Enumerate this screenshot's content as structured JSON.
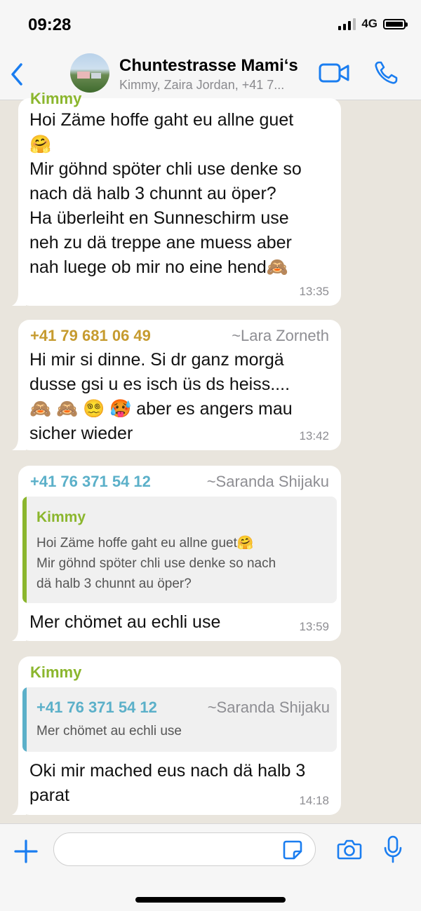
{
  "status": {
    "time": "09:28",
    "network": "4G"
  },
  "header": {
    "title": "Chuntestrasse Mami‘s",
    "subtitle": "Kimmy, Zaira Jordan, +41 7..."
  },
  "messages": [
    {
      "sender": "Kimmy",
      "lines": [
        "Hoi Zäme hoffe gaht eu allne guet",
        "🤗",
        "Mir göhnd spöter chli use denke so",
        "nach dä halb 3 chunnt au öper?",
        "Ha überleiht en Sunneschirm use",
        "neh zu dä treppe ane muess aber",
        "nah luege ob mir no eine hend🙈"
      ],
      "time": "13:35"
    },
    {
      "sender_phone": "+41 79 681 06 49",
      "sender_alias": "~Lara Zorneth",
      "lines": [
        "Hi mir si dinne. Si dr ganz morgä",
        "dusse gsi u es isch üs ds heiss....",
        "🙈 🙈 😵‍💫 🥵 aber es angers mau",
        "sicher wieder"
      ],
      "time": "13:42"
    },
    {
      "sender_phone": "+41 76 371 54 12",
      "sender_alias": "~Saranda Shijaku",
      "quote": {
        "name": "Kimmy",
        "lines": [
          "Hoi Zäme hoffe gaht eu allne guet🤗",
          "Mir göhnd spöter chli use denke so nach",
          "dä halb 3 chunnt au öper?"
        ]
      },
      "text": "Mer chömet au echli use",
      "time": "13:59"
    },
    {
      "sender": "Kimmy",
      "quote": {
        "phone": "+41 76 371 54 12",
        "alias": "~Saranda Shijaku",
        "text": "Mer chömet au echli use"
      },
      "lines": [
        "Oki mir mached eus nach dä halb 3",
        "parat"
      ],
      "time": "14:18"
    }
  ],
  "colors": {
    "kimmy": "#8bb62d",
    "lara": "#c69b2f",
    "saranda": "#5bb0c9",
    "accent": "#1a7df0"
  },
  "input": {
    "placeholder": ""
  }
}
